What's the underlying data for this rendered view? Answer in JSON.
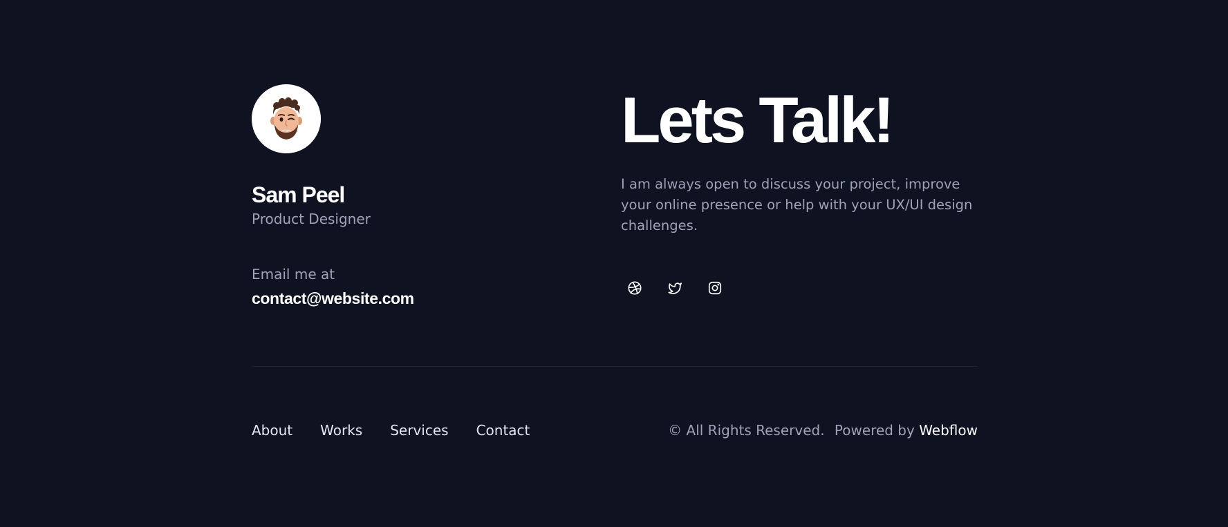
{
  "profile": {
    "avatar_icon": "memoji-avatar-icon",
    "name": "Sam Peel",
    "role": "Product Designer",
    "email_label": "Email me at",
    "email": "contact@website.com"
  },
  "cta": {
    "heading": "Lets Talk!",
    "intro": "I am always open to discuss your project, improve your online presence or help with your UX/UI design challenges."
  },
  "socials": [
    {
      "icon": "dribbble-icon"
    },
    {
      "icon": "twitter-icon"
    },
    {
      "icon": "instagram-icon"
    }
  ],
  "footer": {
    "nav": [
      "About",
      "Works",
      "Services",
      "Contact"
    ],
    "copyright": "© All Rights Reserved.",
    "powered_by": "Powered by",
    "brand": "Webflow"
  },
  "colors": {
    "background": "#0f1220",
    "text_primary": "#ffffff",
    "text_muted": "#9ea3b8",
    "divider": "#1e2233"
  }
}
